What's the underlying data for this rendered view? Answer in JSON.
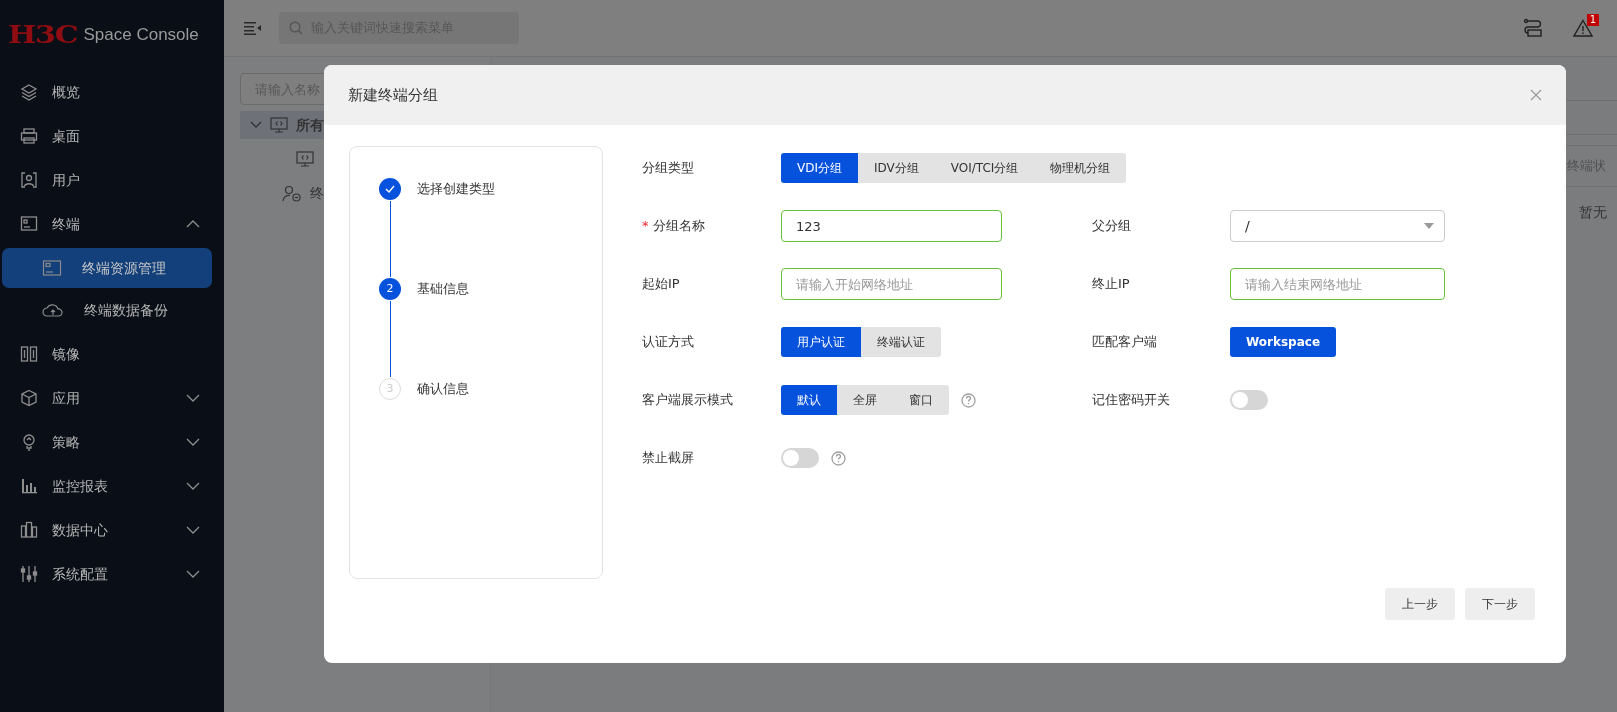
{
  "sidebar": {
    "logo": "H3C",
    "product": "Space Console",
    "items": [
      {
        "label": "概览",
        "selected": false
      },
      {
        "label": "桌面",
        "selected": false
      },
      {
        "label": "用户",
        "selected": false
      },
      {
        "label": "终端",
        "selected": false,
        "expanded": true,
        "children": [
          {
            "label": "终端资源管理",
            "selected": true
          },
          {
            "label": "终端数据备份",
            "selected": false
          }
        ]
      },
      {
        "label": "镜像",
        "selected": false
      },
      {
        "label": "应用",
        "selected": false,
        "expanded": false
      },
      {
        "label": "策略",
        "selected": false,
        "expanded": false
      },
      {
        "label": "监控报表",
        "selected": false,
        "expanded": false
      },
      {
        "label": "数据中心",
        "selected": false,
        "expanded": false
      },
      {
        "label": "系统配置",
        "selected": false,
        "expanded": false
      }
    ]
  },
  "topbar": {
    "search": {
      "placeholder": "输入关键词快速搜索菜单"
    },
    "alert_count": "1"
  },
  "tree_panel": {
    "search": {
      "placeholder": "请输入名称"
    },
    "nodes": [
      {
        "kind": "group",
        "label": "所有",
        "selected": true,
        "expanded": true,
        "children": [
          {
            "kind": "group",
            "selected": false
          }
        ]
      },
      {
        "kind": "user",
        "label": "终",
        "selected": false
      }
    ]
  },
  "table": {
    "columns": [
      "终端状"
    ],
    "empty_text": "暂无"
  },
  "modal": {
    "title": "新建终端分组",
    "steps": [
      {
        "completed": true,
        "label": "选择创建类型"
      },
      {
        "completed": false,
        "current": true,
        "number": "2",
        "label": "基础信息"
      },
      {
        "completed": false,
        "current": false,
        "number": "3",
        "label": "确认信息"
      }
    ],
    "form": {
      "group_type": {
        "label": "分组类型",
        "options": [
          {
            "label": "VDI分组",
            "selected": true
          },
          {
            "label": "IDV分组",
            "selected": false
          },
          {
            "label": "VOI/TCI分组",
            "selected": false
          },
          {
            "label": "物理机分组",
            "selected": false
          }
        ]
      },
      "name": {
        "required_mark": "*",
        "label": "分组名称",
        "value": "123"
      },
      "parent": {
        "label": "父分组",
        "value": "/"
      },
      "start_ip": {
        "label": "起始IP",
        "placeholder": "请输入开始网络地址"
      },
      "end_ip": {
        "label": "终止IP",
        "placeholder": "请输入结束网络地址"
      },
      "auth": {
        "label": "认证方式",
        "options": [
          {
            "label": "用户认证",
            "selected": true
          },
          {
            "label": "终端认证",
            "selected": false
          }
        ]
      },
      "client": {
        "label": "匹配客户端",
        "options": [
          {
            "label": "Workspace",
            "selected": true
          }
        ]
      },
      "display_mode": {
        "label": "客户端展示模式",
        "help": true,
        "options": [
          {
            "label": "默认",
            "selected": true
          },
          {
            "label": "全屏",
            "selected": false
          },
          {
            "label": "窗口",
            "selected": false
          }
        ]
      },
      "remember_password": {
        "label": "记住密码开关",
        "on": false
      },
      "block_screenshot": {
        "label": "禁止截屏",
        "help": true,
        "on": false
      }
    },
    "buttons": [
      "上一步",
      "下一步"
    ]
  }
}
